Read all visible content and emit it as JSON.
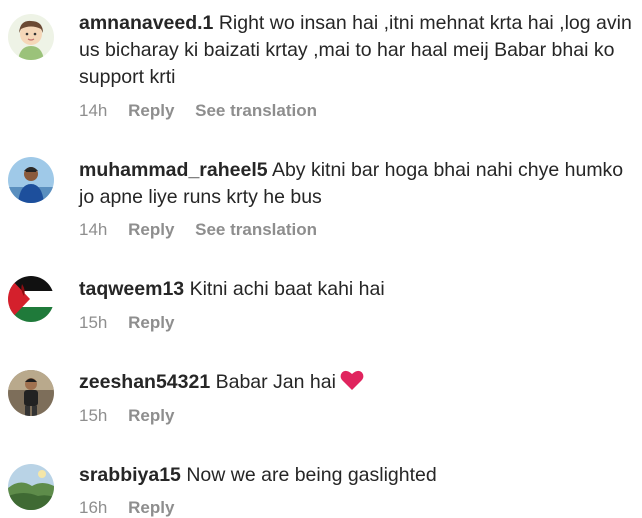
{
  "comments": [
    {
      "username": "amnanaveed.1",
      "text": "Right wo insan hai ,itni mehnat krta hai ,log avin us bicharay ki baizati krtay ,mai to har haal meij Babar bhai ko support krti",
      "lines": [
        "Right wo insan hai ,itni mehnat krta hai ,log avin",
        "us bicharay ki baizati krtay ,mai to har haal meij Babar bhai ko",
        "support krti"
      ],
      "time": "14h",
      "reply": "Reply",
      "translate": "See translation",
      "avatar_icon": "cartoon-girl-avatar-icon"
    },
    {
      "username": "muhammad_raheel5",
      "text": "Aby kitni bar hoga bhai nahi chye humko jo apne liye runs krty he bus",
      "lines": [
        "Aby kitni bar hoga bhai nahi chye humko",
        "jo apne liye runs krty he bus"
      ],
      "time": "14h",
      "reply": "Reply",
      "translate": "See translation",
      "avatar_icon": "man-photo-avatar-icon"
    },
    {
      "username": "taqweem13",
      "text": "Kitni achi baat kahi hai",
      "time": "15h",
      "reply": "Reply",
      "avatar_icon": "palestine-flag-avatar-icon"
    },
    {
      "username": "zeeshan54321",
      "text": "Babar Jan hai",
      "emoji": "red-heart-icon",
      "time": "15h",
      "reply": "Reply",
      "avatar_icon": "man-standing-avatar-icon"
    },
    {
      "username": "srabbiya15",
      "text": "Now we are being gaslighted",
      "time": "16h",
      "reply": "Reply",
      "avatar_icon": "landscape-photo-avatar-icon"
    }
  ],
  "colors": {
    "text": "#262626",
    "meta": "#8e8e8e",
    "heart": "#e0245e"
  }
}
